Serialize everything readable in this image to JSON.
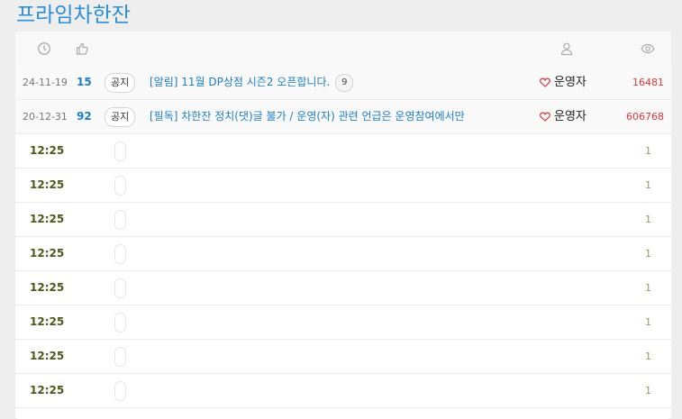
{
  "board": {
    "title": "프라임차한잔"
  },
  "header_icons": [
    "clock-icon",
    "thumbs-up-icon",
    "user-icon",
    "eye-icon"
  ],
  "notices": [
    {
      "date": "24-11-19",
      "number": "15",
      "badge": "공지",
      "subject": "[알림] 11월 DP상점 시즌2 오픈합니다.",
      "comments": "9",
      "author": "운영자",
      "views": "16481"
    },
    {
      "date": "20-12-31",
      "number": "92",
      "badge": "공지",
      "subject": "[필독] 차한잔 정치(댓)글 불가 / 운영(자) 관련 언급은 운영참여에서만",
      "comments": "",
      "author": "운영자",
      "views": "606768"
    }
  ],
  "posts": [
    {
      "time": "12:25",
      "views": "1"
    },
    {
      "time": "12:25",
      "views": "1"
    },
    {
      "time": "12:25",
      "views": "1"
    },
    {
      "time": "12:25",
      "views": "1"
    },
    {
      "time": "12:25",
      "views": "1"
    },
    {
      "time": "12:25",
      "views": "1"
    },
    {
      "time": "12:25",
      "views": "1"
    },
    {
      "time": "12:25",
      "views": "1"
    }
  ],
  "colors": {
    "accent": "#2a8fd6",
    "link": "#1e7dc7",
    "views_notice": "#e0343e",
    "views_post": "#8aa05a",
    "time": "#4a5a1a"
  }
}
